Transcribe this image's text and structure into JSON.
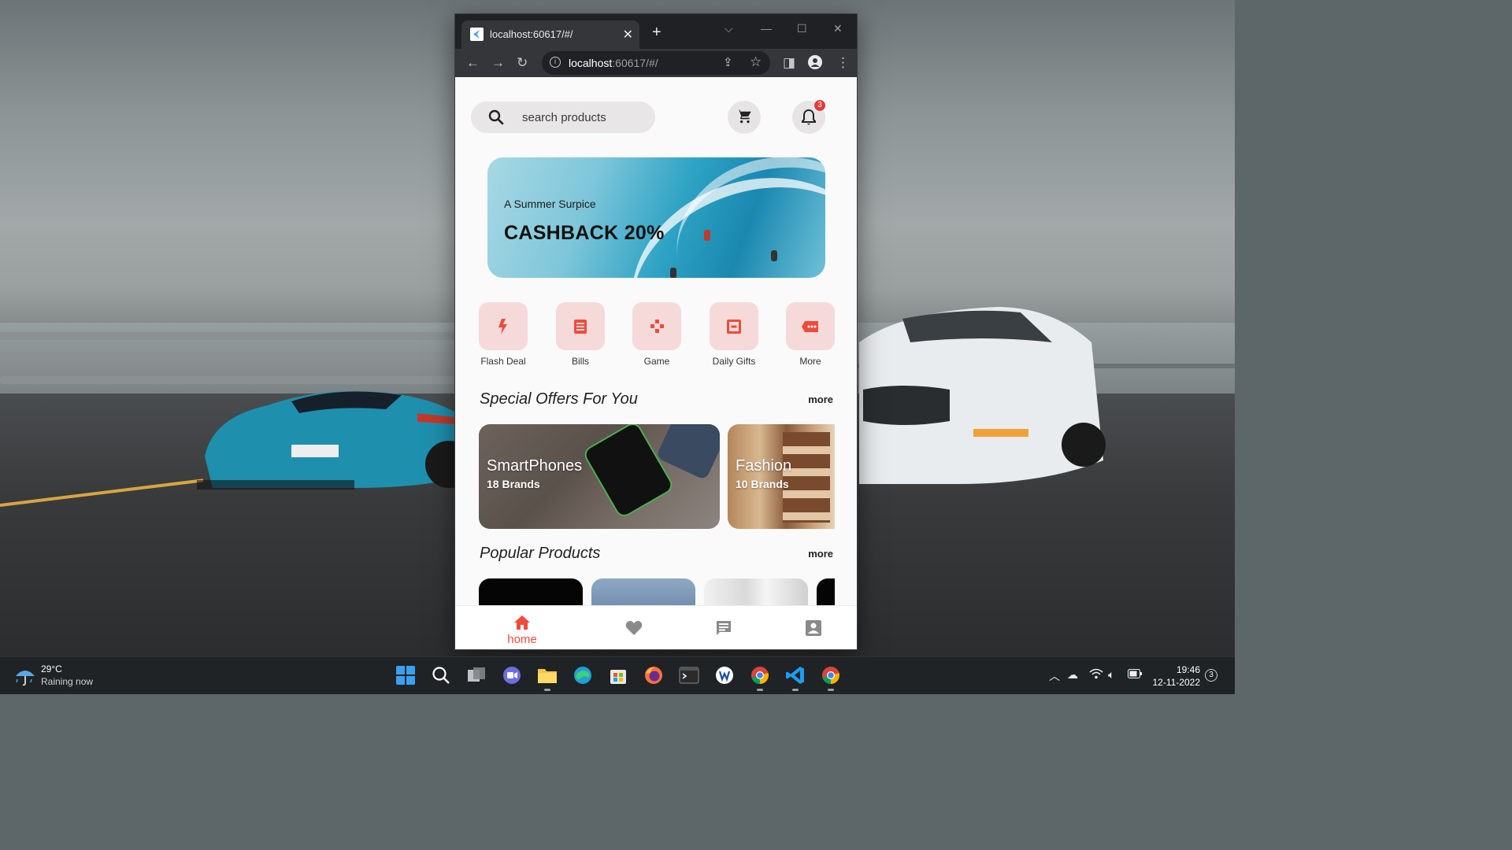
{
  "browser": {
    "tab_title": "localhost:60617/#/",
    "url_host": "localhost",
    "url_rest": ":60617/#/"
  },
  "app": {
    "search": {
      "placeholder": "search products"
    },
    "notifications": {
      "count": "3"
    },
    "banner": {
      "subtitle": "A Summer Surpice",
      "headline": "CASHBACK 20%"
    },
    "categories": [
      {
        "label": "Flash Deal",
        "icon": "flash-icon"
      },
      {
        "label": "Bills",
        "icon": "bill-icon"
      },
      {
        "label": "Game",
        "icon": "game-icon"
      },
      {
        "label": "Daily Gifts",
        "icon": "gift-icon"
      },
      {
        "label": "More",
        "icon": "more-icon"
      }
    ],
    "special_offers": {
      "title": "Special Offers For You",
      "more": "more",
      "items": [
        {
          "name": "SmartPhones",
          "brands": "18 Brands"
        },
        {
          "name": "Fashion",
          "brands": "10 Brands"
        }
      ]
    },
    "popular_products": {
      "title": "Popular Products",
      "more": "more"
    },
    "bottom_nav": [
      {
        "label": "home",
        "icon": "home-icon",
        "active": true
      },
      {
        "label": "",
        "icon": "heart-icon"
      },
      {
        "label": "",
        "icon": "chat-icon"
      },
      {
        "label": "",
        "icon": "profile-icon"
      }
    ],
    "accent_color": "#ef4b3c",
    "category_bg": "#f5dad9"
  },
  "taskbar": {
    "weather_temp": "29°C",
    "weather_condition": "Raining now",
    "time": "19:46",
    "date": "12-11-2022",
    "notification_count": "3"
  }
}
